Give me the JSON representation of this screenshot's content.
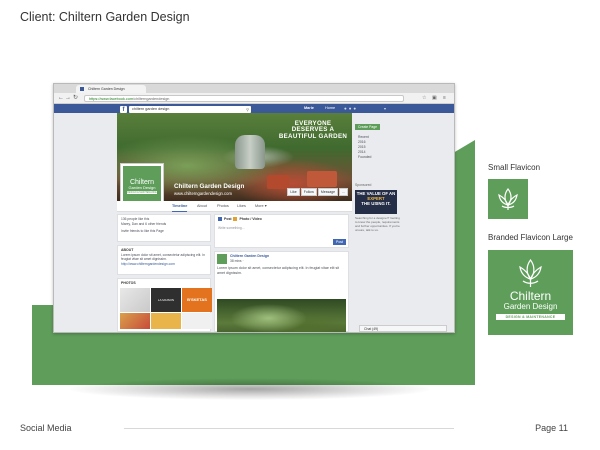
{
  "page": {
    "client_title": "Client: Chiltern Garden Design",
    "footer_left": "Social Media",
    "footer_right": "Page 11"
  },
  "browser": {
    "tab_title": "Chiltern Garden Design",
    "url_secure": "https://www.facebook.com",
    "url_rest": "/chilterngardendesign"
  },
  "facebook": {
    "search_value": "chiltern garden design",
    "user_name": "Marie",
    "home_label": "Home",
    "cover_tagline": "EVERYONE DESERVES A BEAUTIFUL GARDEN",
    "page_name": "Chiltern Garden Design",
    "page_url": "www.chilterngardendesign.com",
    "cover_buttons": [
      "Like",
      "Follow",
      "Message",
      "..."
    ],
    "nav_tabs": [
      "Timeline",
      "About",
      "Photos",
      "Likes",
      "More ▾"
    ],
    "profile": {
      "line1": "Chiltern",
      "line2": "Garden Design",
      "line3": "DESIGN & MAINTENANCE"
    },
    "likes_card": {
      "line1": "136 people like this",
      "line2": "Marey, Dan and 6 other friends",
      "invite": "Invite friends to like this Page"
    },
    "about_card": {
      "heading": "ABOUT",
      "text": "Lorem ipsum dolor sit amet, consectetur adipiscing elit. In feugiat vitae sit amet dignissim.",
      "link": "http://www.chilterngardendesign.com"
    },
    "photos_card": {
      "heading": "PHOTOS",
      "photo_labels": [
        "LA MAISON",
        "B'SKETAS"
      ]
    },
    "composer": {
      "tab_post": "Post",
      "tab_photo": "Photo / Video",
      "placeholder": "Write something...",
      "post_button": "Post"
    },
    "post": {
      "author": "Chiltern Garden Design",
      "time": "38 mins ·",
      "text": "Lorem ipsum dolor sit amet, consectetur adipiscing elit. In feugiat vitae elit sit amet dignissim."
    },
    "right_col": {
      "create_button": "Create Page",
      "years": [
        "Recent",
        "2016",
        "2015",
        "2014",
        "Founded"
      ],
      "sponsored": "Sponsored",
      "ad_line1": "THE VALUE OF AN",
      "ad_highlight": "EXPERT",
      "ad_line2": "THE USING IT.",
      "ad_text": "Searching for a designer? Getting to know the people, requirements and further opportunities. If you're unsure, talk to us.",
      "chat": "Chat (49)"
    }
  },
  "flavicons": {
    "small_label": "Small Flavicon",
    "large_label": "Branded Flavicon Large",
    "brand_name": "Chiltern",
    "brand_sub": "Garden Design",
    "brand_band": "DESIGN & MAINTENANCE"
  },
  "colors": {
    "brand_green": "#5e9e5a",
    "facebook_blue": "#3b5998"
  }
}
